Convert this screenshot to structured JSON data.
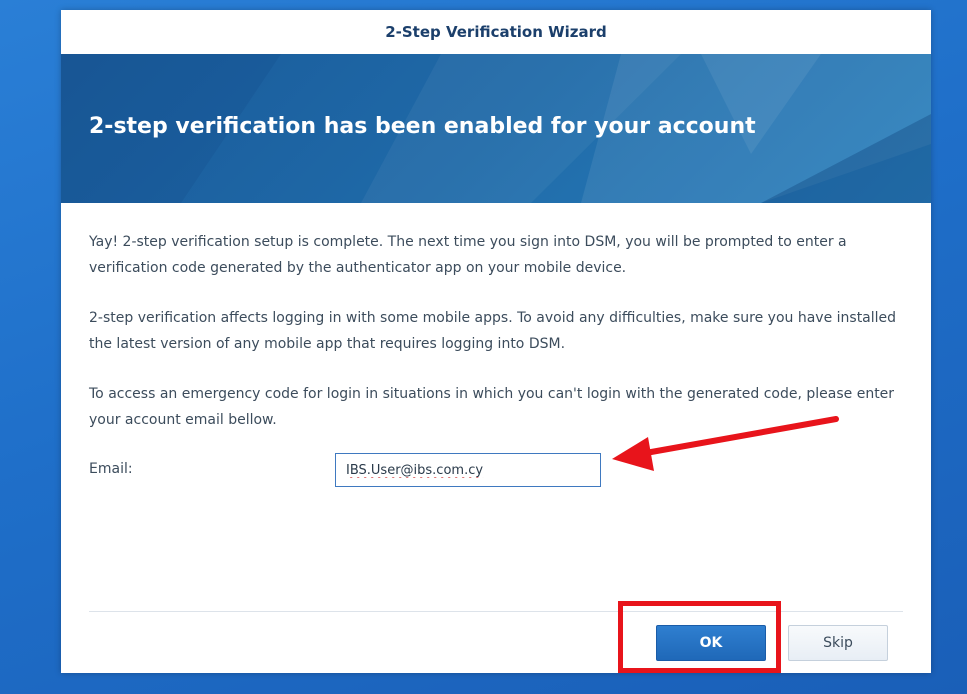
{
  "dialog": {
    "title": "2-Step Verification Wizard",
    "banner_title": "2-step verification has been enabled for your account",
    "paragraphs": [
      "Yay! 2-step verification setup is complete. The next time you sign into DSM, you will be prompted to enter a verification code generated by the authenticator app on your mobile device.",
      "2-step verification affects logging in with some mobile apps. To avoid any difficulties, make sure you have installed the latest version of any mobile app that requires logging into DSM.",
      "To access an emergency code for login in situations in which you can't login with the generated code, please enter your account email bellow."
    ],
    "email": {
      "label": "Email:",
      "value": "IBS.User@ibs.com.cy"
    },
    "buttons": {
      "ok_label": "OK",
      "skip_label": "Skip"
    }
  },
  "annotations": {
    "arrow_color": "#e8141b",
    "highlight_color": "#e8141b"
  },
  "colors": {
    "desktop_blue": "#1f6fc9",
    "banner_blue": "#1f6aa8",
    "ok_button": "#2471c2"
  }
}
